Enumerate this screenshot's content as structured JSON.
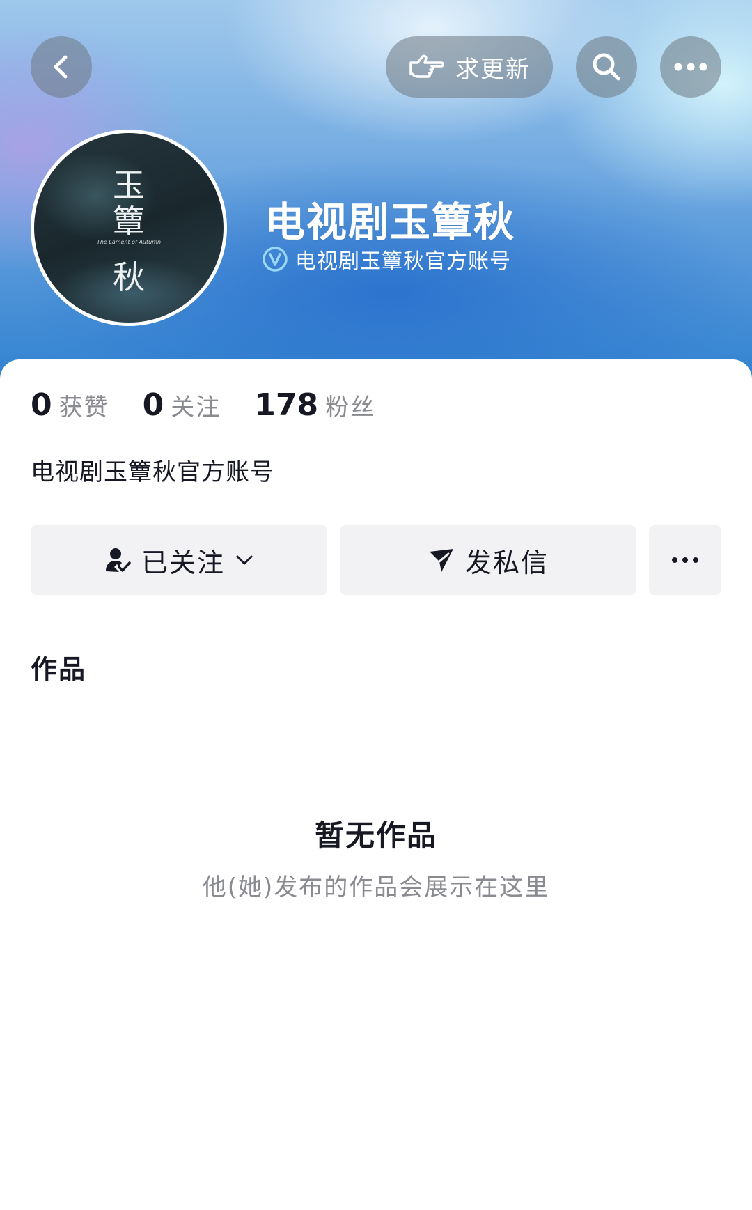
{
  "header": {
    "request_update_label": "求更新"
  },
  "profile": {
    "name": "电视剧玉簟秋",
    "verified_text": "电视剧玉簟秋官方账号",
    "avatar": {
      "title_chars": [
        "玉",
        "簟",
        "秋"
      ],
      "subtitle": "The Lament of Autumn"
    }
  },
  "stats": [
    {
      "value": "0",
      "label": "获赞"
    },
    {
      "value": "0",
      "label": "关注"
    },
    {
      "value": "178",
      "label": "粉丝"
    }
  ],
  "bio": "电视剧玉簟秋官方账号",
  "actions": {
    "follow_label": "已关注",
    "message_label": "发私信"
  },
  "tabs": {
    "works_label": "作品"
  },
  "empty_state": {
    "title": "暂无作品",
    "description": "他(她)发布的作品会展示在这里"
  },
  "colors": {
    "header_blue": "#2f80d0",
    "text_primary": "#161823",
    "text_secondary": "#8a8b91",
    "button_bg": "#f2f2f4",
    "verify_badge": "#9ad6f5"
  }
}
